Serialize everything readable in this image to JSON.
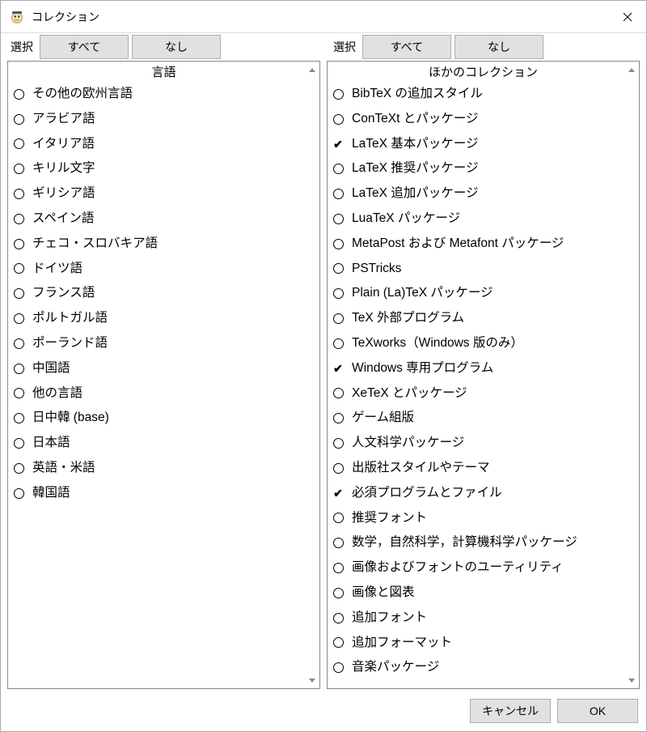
{
  "window": {
    "title": "コレクション"
  },
  "left": {
    "select_label": "選択",
    "all_button": "すべて",
    "none_button": "なし",
    "header": "言語",
    "items": [
      {
        "label": "その他の欧州言語",
        "checked": false
      },
      {
        "label": "アラビア語",
        "checked": false
      },
      {
        "label": "イタリア語",
        "checked": false
      },
      {
        "label": "キリル文字",
        "checked": false
      },
      {
        "label": "ギリシア語",
        "checked": false
      },
      {
        "label": "スペイン語",
        "checked": false
      },
      {
        "label": "チェコ・スロバキア語",
        "checked": false
      },
      {
        "label": "ドイツ語",
        "checked": false
      },
      {
        "label": "フランス語",
        "checked": false
      },
      {
        "label": "ポルトガル語",
        "checked": false
      },
      {
        "label": "ポーランド語",
        "checked": false
      },
      {
        "label": "中国語",
        "checked": false
      },
      {
        "label": "他の言語",
        "checked": false
      },
      {
        "label": "日中韓 (base)",
        "checked": false
      },
      {
        "label": "日本語",
        "checked": false
      },
      {
        "label": "英語・米語",
        "checked": false
      },
      {
        "label": "韓国語",
        "checked": false
      }
    ]
  },
  "right": {
    "select_label": "選択",
    "all_button": "すべて",
    "none_button": "なし",
    "header": "ほかのコレクション",
    "items": [
      {
        "label": "BibTeX の追加スタイル",
        "checked": false
      },
      {
        "label": "ConTeXt とパッケージ",
        "checked": false
      },
      {
        "label": "LaTeX 基本パッケージ",
        "checked": true
      },
      {
        "label": "LaTeX 推奨パッケージ",
        "checked": false
      },
      {
        "label": "LaTeX 追加パッケージ",
        "checked": false
      },
      {
        "label": "LuaTeX パッケージ",
        "checked": false
      },
      {
        "label": "MetaPost および Metafont パッケージ",
        "checked": false
      },
      {
        "label": "PSTricks",
        "checked": false
      },
      {
        "label": "Plain (La)TeX パッケージ",
        "checked": false
      },
      {
        "label": "TeX 外部プログラム",
        "checked": false
      },
      {
        "label": "TeXworks（Windows 版のみ）",
        "checked": false
      },
      {
        "label": "Windows 専用プログラム",
        "checked": true
      },
      {
        "label": "XeTeX とパッケージ",
        "checked": false
      },
      {
        "label": "ゲーム組版",
        "checked": false
      },
      {
        "label": "人文科学パッケージ",
        "checked": false
      },
      {
        "label": "出版社スタイルやテーマ",
        "checked": false
      },
      {
        "label": "必須プログラムとファイル",
        "checked": true
      },
      {
        "label": "推奨フォント",
        "checked": false
      },
      {
        "label": "数学，自然科学，計算機科学パッケージ",
        "checked": false
      },
      {
        "label": "画像およびフォントのユーティリティ",
        "checked": false
      },
      {
        "label": "画像と図表",
        "checked": false
      },
      {
        "label": "追加フォント",
        "checked": false
      },
      {
        "label": "追加フォーマット",
        "checked": false
      },
      {
        "label": "音楽パッケージ",
        "checked": false
      }
    ]
  },
  "footer": {
    "cancel": "キャンセル",
    "ok": "OK"
  }
}
